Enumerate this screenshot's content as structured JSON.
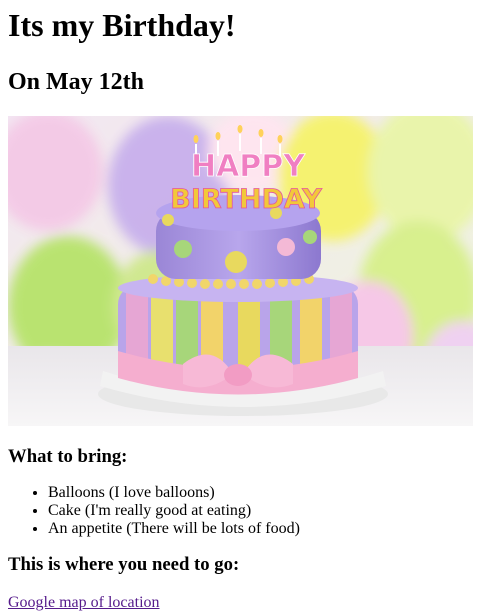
{
  "page": {
    "title": "Its my Birthday!",
    "date": "On May 12th"
  },
  "hero": {
    "cake_text_line1": "HAPPY",
    "cake_text_line2": "BIRTHDAY"
  },
  "bring": {
    "heading": "What to bring:",
    "items": [
      "Balloons (I love balloons)",
      "Cake (I'm really good at eating)",
      "An appetite (There will be lots of food)"
    ]
  },
  "location": {
    "heading": "This is where you need to go:",
    "link_label": "Google map of location"
  },
  "colors": {
    "link": "#551a8b"
  }
}
